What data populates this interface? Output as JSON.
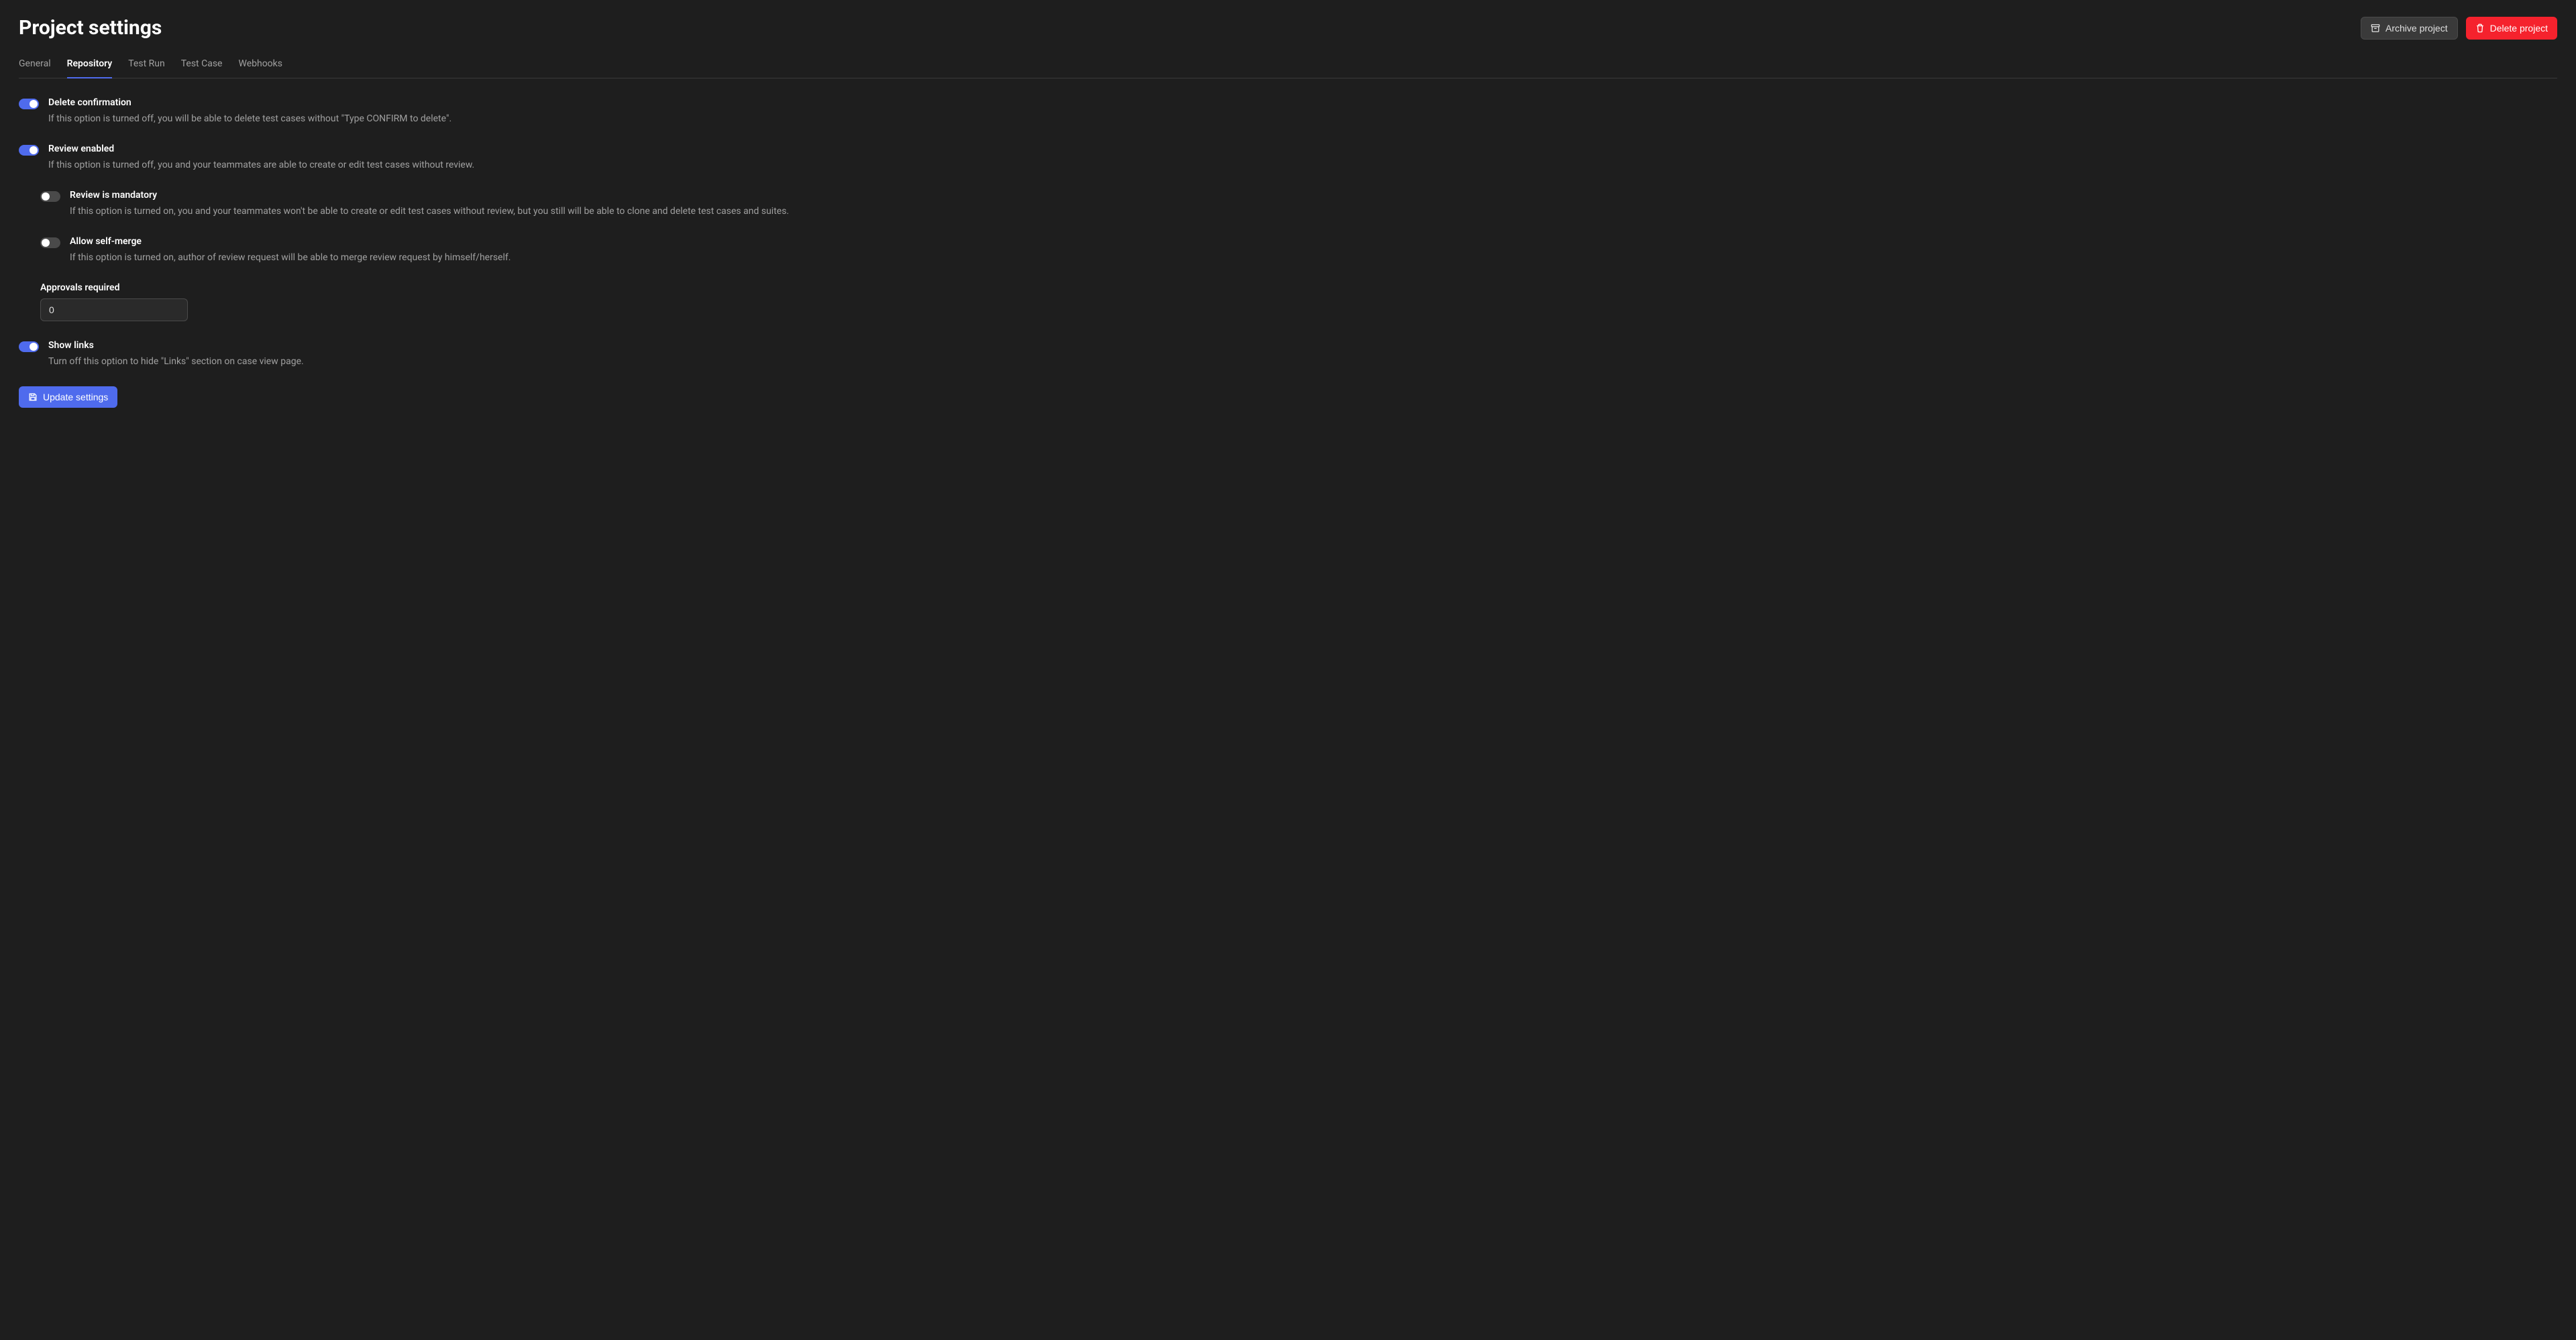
{
  "page": {
    "title": "Project settings"
  },
  "header_actions": {
    "archive_label": "Archive project",
    "delete_label": "Delete project"
  },
  "tabs": {
    "general": "General",
    "repository": "Repository",
    "test_run": "Test Run",
    "test_case": "Test Case",
    "webhooks": "Webhooks"
  },
  "settings": {
    "delete_confirmation": {
      "title": "Delete confirmation",
      "desc": "If this option is turned off, you will be able to delete test cases without \"Type CONFIRM to delete\".",
      "enabled": true
    },
    "review_enabled": {
      "title": "Review enabled",
      "desc": "If this option is turned off, you and your teammates are able to create or edit test cases without review.",
      "enabled": true
    },
    "review_mandatory": {
      "title": "Review is mandatory",
      "desc": "If this option is turned on, you and your teammates won't be able to create or edit test cases without review, but you still will be able to clone and delete test cases and suites.",
      "enabled": false
    },
    "allow_self_merge": {
      "title": "Allow self-merge",
      "desc": "If this option is turned on, author of review request will be able to merge review request by himself/herself.",
      "enabled": false
    },
    "approvals_required": {
      "label": "Approvals required",
      "value": "0"
    },
    "show_links": {
      "title": "Show links",
      "desc": "Turn off this option to hide \"Links\" section on case view page.",
      "enabled": true
    }
  },
  "footer": {
    "update_label": "Update settings"
  }
}
